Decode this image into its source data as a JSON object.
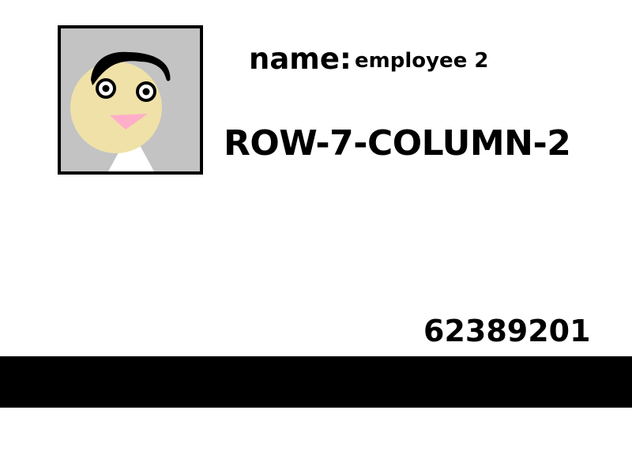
{
  "badge": {
    "name_label": "name:",
    "name_value": "employee 2",
    "location_code": "ROW-7-COLUMN-2",
    "badge_number": "62389201"
  },
  "colors": {
    "photo_background": "#c3c3c3",
    "face": "#efe1a8",
    "hair": "#000000",
    "mouth": "#ffaec9",
    "shirt": "#ffffff",
    "stripe": "#000000"
  },
  "icons": {
    "photo": "employee-portrait-icon"
  }
}
